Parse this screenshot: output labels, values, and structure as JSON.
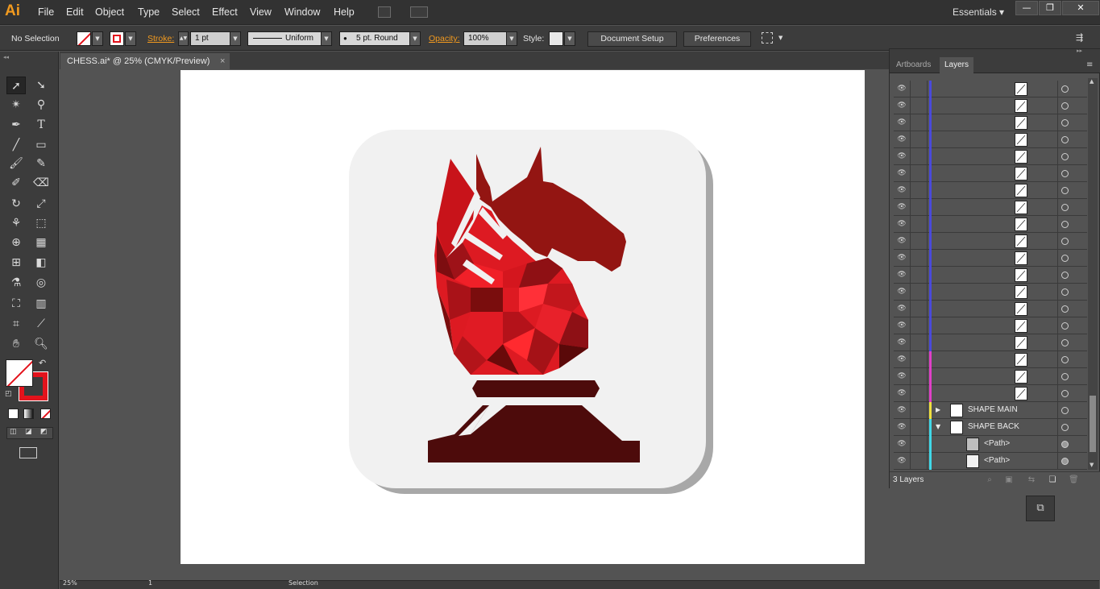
{
  "app": {
    "logo": "Ai",
    "workspace": "Essentials",
    "workspace_caret": "▾"
  },
  "menu": [
    "File",
    "Edit",
    "Object",
    "Type",
    "Select",
    "Effect",
    "View",
    "Window",
    "Help"
  ],
  "window_controls": [
    "—",
    "❐",
    "✕"
  ],
  "control": {
    "selection": "No Selection",
    "stroke_label": "Stroke:",
    "stroke_weight": "1 pt",
    "stroke_profile": "Uniform",
    "brush": "5 pt. Round",
    "opacity_label": "Opacity:",
    "opacity": "100%",
    "style_label": "Style:",
    "document_setup": "Document Setup",
    "preferences": "Preferences"
  },
  "document": {
    "tab_title": "CHESS.ai* @ 25% (CMYK/Preview)",
    "close": "×"
  },
  "colors": {
    "accent_orange": "#f29a1f",
    "knight_dark": "#8f1212",
    "knight_red": "#e3131c",
    "base": "#4d0b0b",
    "card_bg": "#f1f1f1",
    "card_shadow": "#a8a8a8",
    "layer_blue": "#4a4adb",
    "layer_magenta": "#e040c8",
    "layer_yellow": "#f0e040",
    "layer_cyan": "#40d8e8"
  },
  "layers_panel": {
    "tabs": [
      "Artboards",
      "Layers"
    ],
    "active_tab": "Layers",
    "rows": [
      {
        "type": "path",
        "color": "blue"
      },
      {
        "type": "path",
        "color": "blue"
      },
      {
        "type": "path",
        "color": "blue"
      },
      {
        "type": "path",
        "color": "blue"
      },
      {
        "type": "path",
        "color": "blue"
      },
      {
        "type": "path",
        "color": "blue"
      },
      {
        "type": "path",
        "color": "blue"
      },
      {
        "type": "path",
        "color": "blue"
      },
      {
        "type": "path",
        "color": "blue"
      },
      {
        "type": "path",
        "color": "blue"
      },
      {
        "type": "path",
        "color": "blue"
      },
      {
        "type": "path",
        "color": "blue"
      },
      {
        "type": "path",
        "color": "blue"
      },
      {
        "type": "path",
        "color": "blue"
      },
      {
        "type": "path",
        "color": "blue"
      },
      {
        "type": "path",
        "color": "blue"
      },
      {
        "type": "path",
        "color": "magenta"
      },
      {
        "type": "path",
        "color": "magenta"
      },
      {
        "type": "path",
        "color": "magenta"
      },
      {
        "type": "layer",
        "name": "SHAPE MAIN",
        "color": "yellow",
        "expanded": false
      },
      {
        "type": "layer",
        "name": "SHAPE BACK",
        "color": "cyan",
        "expanded": true
      },
      {
        "type": "sublayer",
        "name": "<Path>",
        "color": "cyan"
      },
      {
        "type": "sublayer",
        "name": "<Path>",
        "color": "cyan"
      }
    ],
    "footer_count": "3 Layers"
  },
  "status": {
    "zoom": "25%",
    "page": "1",
    "tool": "Selection"
  }
}
